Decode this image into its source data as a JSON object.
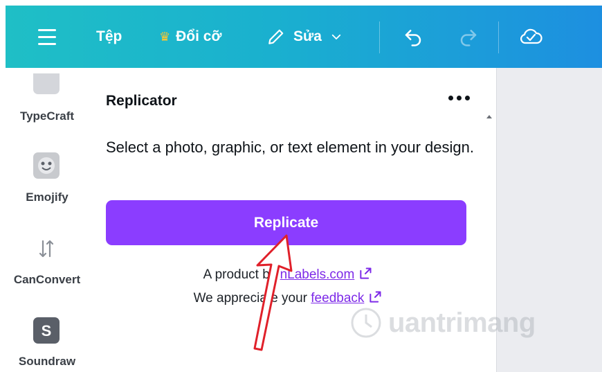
{
  "toolbar": {
    "file_label": "Tệp",
    "resize_label": "Đổi cỡ",
    "edit_label": "Sửa"
  },
  "rail": {
    "items": [
      {
        "label": "TypeCraft",
        "icon": "typecraft-icon"
      },
      {
        "label": "Emojify",
        "icon": "emojify-icon"
      },
      {
        "label": "CanConvert",
        "icon": "canconvert-icon"
      },
      {
        "label": "Soundraw",
        "icon": "soundraw-icon"
      }
    ]
  },
  "panel": {
    "title": "Replicator",
    "instructions": "Select a photo, graphic, or text element in your design.",
    "button_label": "Replicate",
    "credit_prefix": "A product by ",
    "credit_link": "nLabels.com",
    "feedback_prefix": "We appreciate your ",
    "feedback_link": "feedback"
  },
  "watermark": {
    "text": "uantrimang"
  },
  "colors": {
    "accent": "#8b3dff",
    "link": "#7d2ae8",
    "topbar_start": "#1fbfc6",
    "topbar_end": "#1d8fe0",
    "annotation_arrow": "#e0202a"
  }
}
